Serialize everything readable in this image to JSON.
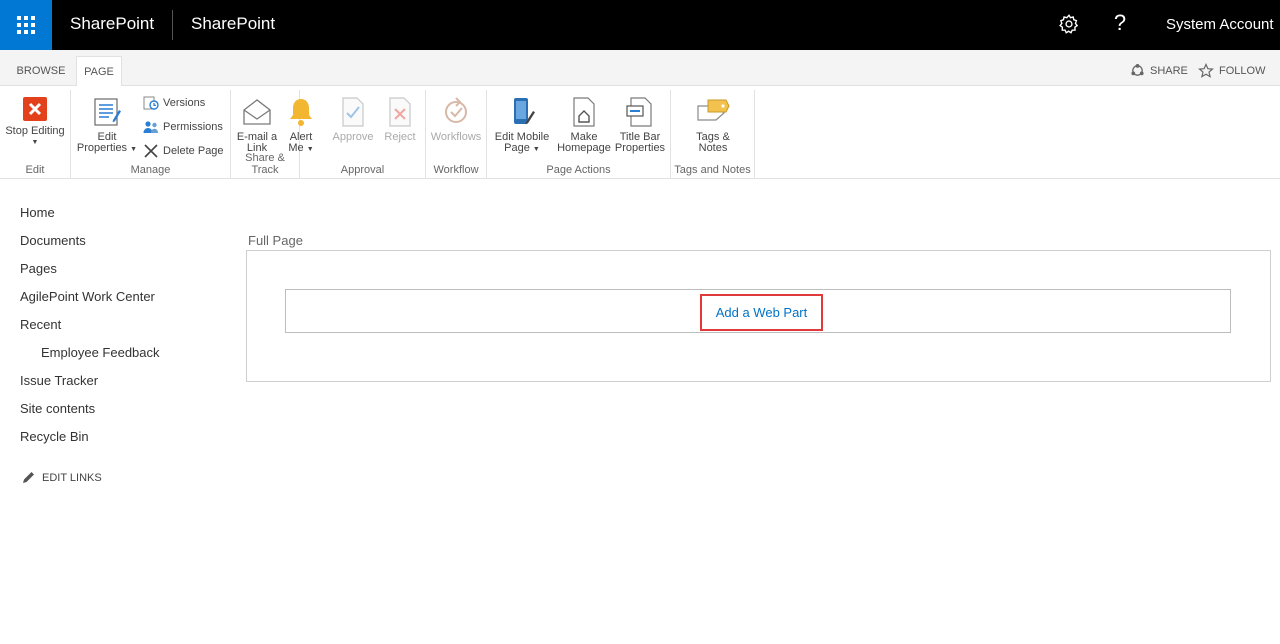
{
  "suitebar": {
    "brand": "SharePoint",
    "site_title": "SharePoint",
    "help_label": "?",
    "account": "System Account"
  },
  "tabs": {
    "browse": "BROWSE",
    "page": "PAGE"
  },
  "actions": {
    "share": "SHARE",
    "follow": "FOLLOW"
  },
  "ribbon": {
    "edit": {
      "stop_editing": "Stop Editing",
      "label": "Edit"
    },
    "manage": {
      "edit_properties_1": "Edit",
      "edit_properties_2": "Properties",
      "versions": "Versions",
      "permissions": "Permissions",
      "delete_page": "Delete Page",
      "label": "Manage"
    },
    "share_track": {
      "email_1": "E-mail a",
      "email_2": "Link",
      "alert_1": "Alert",
      "alert_2": "Me",
      "label": "Share & Track"
    },
    "approval": {
      "approve": "Approve",
      "reject": "Reject",
      "label": "Approval"
    },
    "workflow": {
      "workflows": "Workflows",
      "label": "Workflow"
    },
    "page_actions": {
      "edit_mobile_1": "Edit Mobile",
      "edit_mobile_2": "Page",
      "make_home_1": "Make",
      "make_home_2": "Homepage",
      "title_bar_1": "Title Bar",
      "title_bar_2": "Properties",
      "label": "Page Actions"
    },
    "tags_notes": {
      "tags_1": "Tags &",
      "tags_2": "Notes",
      "label": "Tags and Notes"
    }
  },
  "nav": {
    "items": [
      "Home",
      "Documents",
      "Pages",
      "AgilePoint Work Center",
      "Recent",
      "Employee Feedback",
      "Issue Tracker",
      "Site contents",
      "Recycle Bin"
    ],
    "edit_links": "EDIT LINKS"
  },
  "main": {
    "zone_title": "Full Page",
    "add_web_part": "Add a Web Part"
  },
  "colors": {
    "accent": "#0078d4",
    "link": "#0072c6",
    "highlight": "#e03a3a"
  }
}
